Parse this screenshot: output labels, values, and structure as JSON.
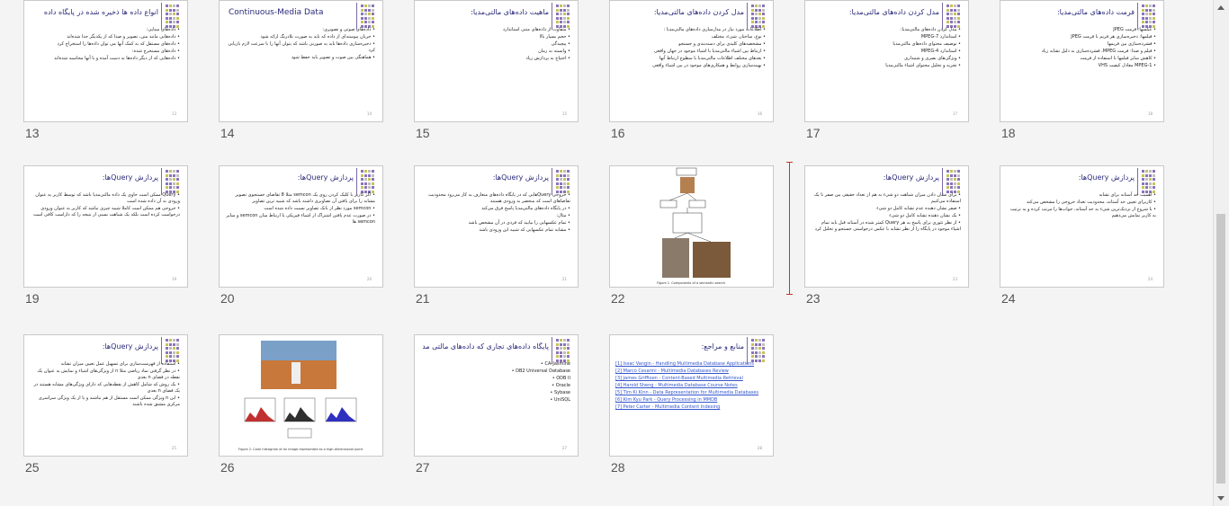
{
  "deco_colors": [
    "#8c74b8",
    "#c6c25a",
    "#bfbfbf",
    "#8c74b8"
  ],
  "slides": [
    {
      "num": "13",
      "title": "انواع داده ها ذخیره شده در پایگاه داده",
      "title_ltr": false,
      "lines": [
        "داده‌های مبنایی:",
        "داده‌هایی مانند متن، تصویر و صدا که از یکدیگر جدا شده‌اند",
        "داده‌های مستقل که به کمک آنها می توان داده‌ها را استخراج کرد",
        "داده‌های مستخرج شده:",
        "داده‌هایی که از دیگر داده‌ها به دست آمده و با آنها محاسبه شده‌اند"
      ],
      "page": "13"
    },
    {
      "num": "14",
      "title": "Continuous-Media Data",
      "title_ltr": true,
      "lines": [
        "داده‌های صوتی و تصویری:",
        "جریان پیوسته‌ای از داده که باید به صورت بلادرنگ ارائه شود",
        "ذخیره‌سازی داده‌ها باید به صورتی باشد که بتوان آنها را با سرعت لازم بازیابی کرد",
        "هماهنگی بین صوت و تصویر باید حفظ شود"
      ],
      "page": "14"
    },
    {
      "num": "15",
      "title": "ماهیت داده‌های مالتی‌مدیا:",
      "title_ltr": false,
      "lines": [
        "متفاوت از داده‌های متنی استاندارد",
        "حجم بسیار بالا",
        "پیچیدگی",
        "وابسته به زمان",
        "احتیاج به پردازش زیاد"
      ],
      "page": "15"
    },
    {
      "num": "16",
      "title": "مدل کردن داده‌های مالتی‌مدیا:",
      "title_ltr": false,
      "lines": [
        "اطلاعات مورد نیاز در مدل‌سازی داده‌های مالتی‌مدیا :",
        "نوع، ساختار، شیء، مختلف",
        "مشخصه‌های کلیدی برای دسته‌بندی و جستجو",
        "ارتباط بین اشیاء مالتی‌مدیا با اشیاء موجود در جهان واقعی",
        "بعدهای مختلف اطلاعات مالتی‌مدیا با سطوح ارتباط آنها",
        "بهینه‌سازی روابط و همکاری‌های موجود در بین اشیاء واقعی"
      ],
      "page": "16"
    },
    {
      "num": "17",
      "title": "مدل کردن داده‌های مالتی‌مدیا:",
      "title_ltr": false,
      "lines": [
        "مدل کردن داده‌های مالتی‌مدیا:",
        "استاندارد MPEG-7",
        "توصیف محتوای داده‌های مالتی‌مدیا",
        "استاندارد MPEG-4",
        "ویژگی‌های بصری و شنیداری",
        "تجزیه و تحلیل محتوای اشیاء مالتی‌مدیا"
      ],
      "page": "17"
    },
    {
      "num": "18",
      "title": "فرمت داده‌های مالتی‌مدیا:",
      "title_ltr": false,
      "lines": [
        "عکسها: فرمت JPEG",
        "فیلمها: ذخیره‌سازی هر فریم با فرمت JPEG",
        "فشرده‌سازی بین فریمها",
        "فیلم و صدا: فرمت MPEG، فشرده‌سازی به دلیل تشابه زیاد",
        "کاهش سایز فیلمها با استفاده از فرمت",
        "MPEG-1 معادل کیفیت VHS"
      ],
      "page": "18"
    },
    {
      "num": "19",
      "title": "پردازش Queryها:",
      "title_ltr": false,
      "lines": [
        "Query ممکن است حاوی یک داده مالتی‌مدیا باشد که توسط کاربر به عنوان ورودی به آن داده شده است",
        "خروجی هم ممکن است کاملا شبیه چیزی نباشد که کاربر به عنوان ورودی درخواست کرده است بلکه یک شباهت نسبی از نتیجه را که داراست کافی است"
      ],
      "page": "19"
    },
    {
      "num": "20",
      "title": "پردازش Queryها:",
      "title_ltr": false,
      "lines": [
        "اگر کاربر با کلیک کردن روی یک semcon مثلا 8 تقاضای جستجوی تصویر مشابه را برای یافتن آن تصاویری داشته باشد که شبیه ترین تصاویر",
        "semcon مورد نظر از بانک تصاویر نسبت داده شده است",
        "در صورت عدم یافتن اشتراک از اشیاء فیزیکی یا ارتباط میان semcon و سایر semcon ها"
      ],
      "page": "20"
    },
    {
      "num": "21",
      "title": "پردازش Queryها:",
      "title_ltr": false,
      "lines": [
        "خروجی Query‌هایی که در پایگاه داده‌های متعارف به کار می‌رود محدودیت تقاضاهای است که منحصر به ورودی هستند",
        "در پایگاه داده‌های مالتی‌مدیا پاسخ فرق می‌کند",
        "مثال:",
        "تمام عکسهایی را بیابید که فردی در آن مشخص باشد",
        "مشابه تمام عکسهایی که شبیه این ورودی باشد"
      ],
      "page": "21"
    },
    {
      "num": "22",
      "title": "",
      "title_ltr": true,
      "lines": [],
      "page": "",
      "figure": "photo-graph",
      "caption": "Figure 1. Components of a semantic search"
    },
    {
      "num": "23",
      "title": "پردازش Queryها:",
      "title_ltr": false,
      "lines": [
        "برای نشان دادن میزان شباهت دو شیء به هم از تعداد حقیقی بین صفر تا یک استفاده می‌کنیم",
        "صفر نشان دهنده عدم تشابه کامل دو شیء",
        "یک نشان دهنده تشابه کامل دو شیء",
        "از نظر تئوری برای پاسخ به هر Query کمتر شده در آستانه قبل باید تمام اشیاء موجود در پایگاه را از نظر تشابه با عکس درخواستی جستجو و تحلیل کرد"
      ],
      "page": "23"
    },
    {
      "num": "24",
      "title": "پردازش Queryها:",
      "title_ltr": false,
      "lines": [
        "اهمیت حد آستانه برای تشابه",
        "کاربرای تعیین حد آستانه، محدودیت تعداد خروجی را مشخص می‌کند",
        "با شروع از نزدیک‌ترین شیء به حد آستانه، جواب‌ها را مرتب کرده و به ترتیب به کاربر نمایش می‌دهیم"
      ],
      "page": "24"
    },
    {
      "num": "25",
      "title": "پردازش Queryها:",
      "title_ltr": false,
      "lines": [
        "استفاده از فهرست‌سازی برای تسهیل عمل تعیین میزان تشابه",
        "در نظر گرفتن نماد ریاضی مثلا n از ویژگی‌های اشیاء و نمایش به عنوان یک نقطه در فضای n بعدی",
        "یک روش که شامل کاهش از نقطه‌هایی که دارای ویژگی‌های مشابه هستند در یک فضای n بعدی",
        "این n ویژگی ممکن است مستقل از هم نباشند و یا از یک ویژگی سراسری مرکزی مشتق شده باشند"
      ],
      "page": "25"
    },
    {
      "num": "26",
      "title": "",
      "title_ltr": true,
      "lines": [],
      "page": "",
      "figure": "photo-histogram",
      "caption": "Figure 2. Color histogram of an image represented as a high-dimensional point"
    },
    {
      "num": "27",
      "title": "پایگاه داده‌های تجاری که داده‌های مالتی مدیا را پشتیبانی می‌کنند:",
      "title_ltr": false,
      "lines": [
        "CA-Jasmine",
        "DB2 Universal Database",
        "ODB II",
        "Oracle",
        "Sybase",
        "UniSQL"
      ],
      "page": "27",
      "ltr_lines": true
    },
    {
      "num": "28",
      "title": "منابع و مراجع:",
      "title_ltr": false,
      "lines": [
        "[1] Issac Vangin - Handling Multimedia Database Applications",
        "[2] Marco Cesarini - Multimedia Databases Review",
        "[3] James Griffioen - Content-Based Multimedia Retrieval",
        "[4] Harold Sheng - Multimedia Database Course Notes",
        "[5] Tim Ki Kinn - Data Representation for Multimedia Databases",
        "[6] Kim Kyu Park - Query Processing in MMDB",
        "[7] Peter Carter - Multimedia Content Indexing"
      ],
      "page": "28",
      "links": true
    }
  ]
}
